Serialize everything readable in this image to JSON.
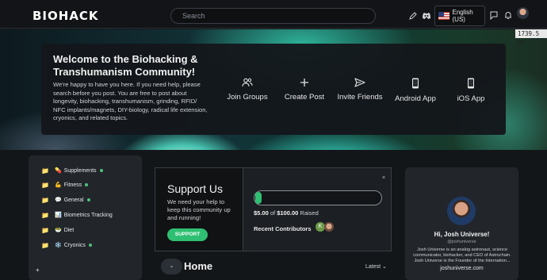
{
  "header": {
    "logo": "BIOHACK",
    "search_placeholder": "Search",
    "language": "English (US)",
    "timing": "1739.5 ms"
  },
  "banner": {
    "title": "Welcome to the Biohacking & Transhumanism Community!",
    "text": "We're happy to have you here. If you need help, please search before you post. You are free to post about longevity, biohacking, transhumanism, grinding, RFID/ NFC implants/magnets, DIY-biology, radical life extension, cryonics, and related topics.",
    "actions": [
      {
        "label": "Join Groups",
        "icon": "users-icon"
      },
      {
        "label": "Create Post",
        "icon": "plus-icon"
      },
      {
        "label": "Invite Friends",
        "icon": "send-icon"
      },
      {
        "label": "Android App",
        "icon": "phone-icon"
      },
      {
        "label": "iOS App",
        "icon": "phone-icon"
      }
    ]
  },
  "sidebar": {
    "items": [
      {
        "emoji": "💊",
        "label": "Supplements",
        "online": true
      },
      {
        "emoji": "💪",
        "label": "Fitness",
        "online": true
      },
      {
        "emoji": "💬",
        "label": "General",
        "online": true
      },
      {
        "emoji": "📊",
        "label": "Biometrics Tracking",
        "online": false
      },
      {
        "emoji": "🥗",
        "label": "Diet",
        "online": false
      },
      {
        "emoji": "❄️",
        "label": "Cryonics",
        "online": true
      }
    ]
  },
  "support": {
    "title": "Support Us",
    "text": "We need your help to keep this community up and running!",
    "button": "SUPPORT",
    "close": "×",
    "raised_amount": "$5.00",
    "raised_of": " of ",
    "raised_goal": "$100.00",
    "raised_suffix": " Raised",
    "progress_fraction": 0.05,
    "contributors_label": "Recent Contributors",
    "contributor_initial": "K"
  },
  "home": {
    "title": "Home",
    "sort": "Latest ⌄",
    "toggle": "⌄"
  },
  "profile": {
    "greeting": "Hi, Josh Universe!",
    "handle": "@joshuniverse",
    "bio": "Josh Universe is an analog astronaut, science communicator, biohacker, and CEO of Astrochain. Josh Universe is the Founder of the Internation...",
    "site": "joshuniverse.com"
  },
  "colors": {
    "accent": "#2fbf72",
    "folder": "#f0c24b"
  }
}
